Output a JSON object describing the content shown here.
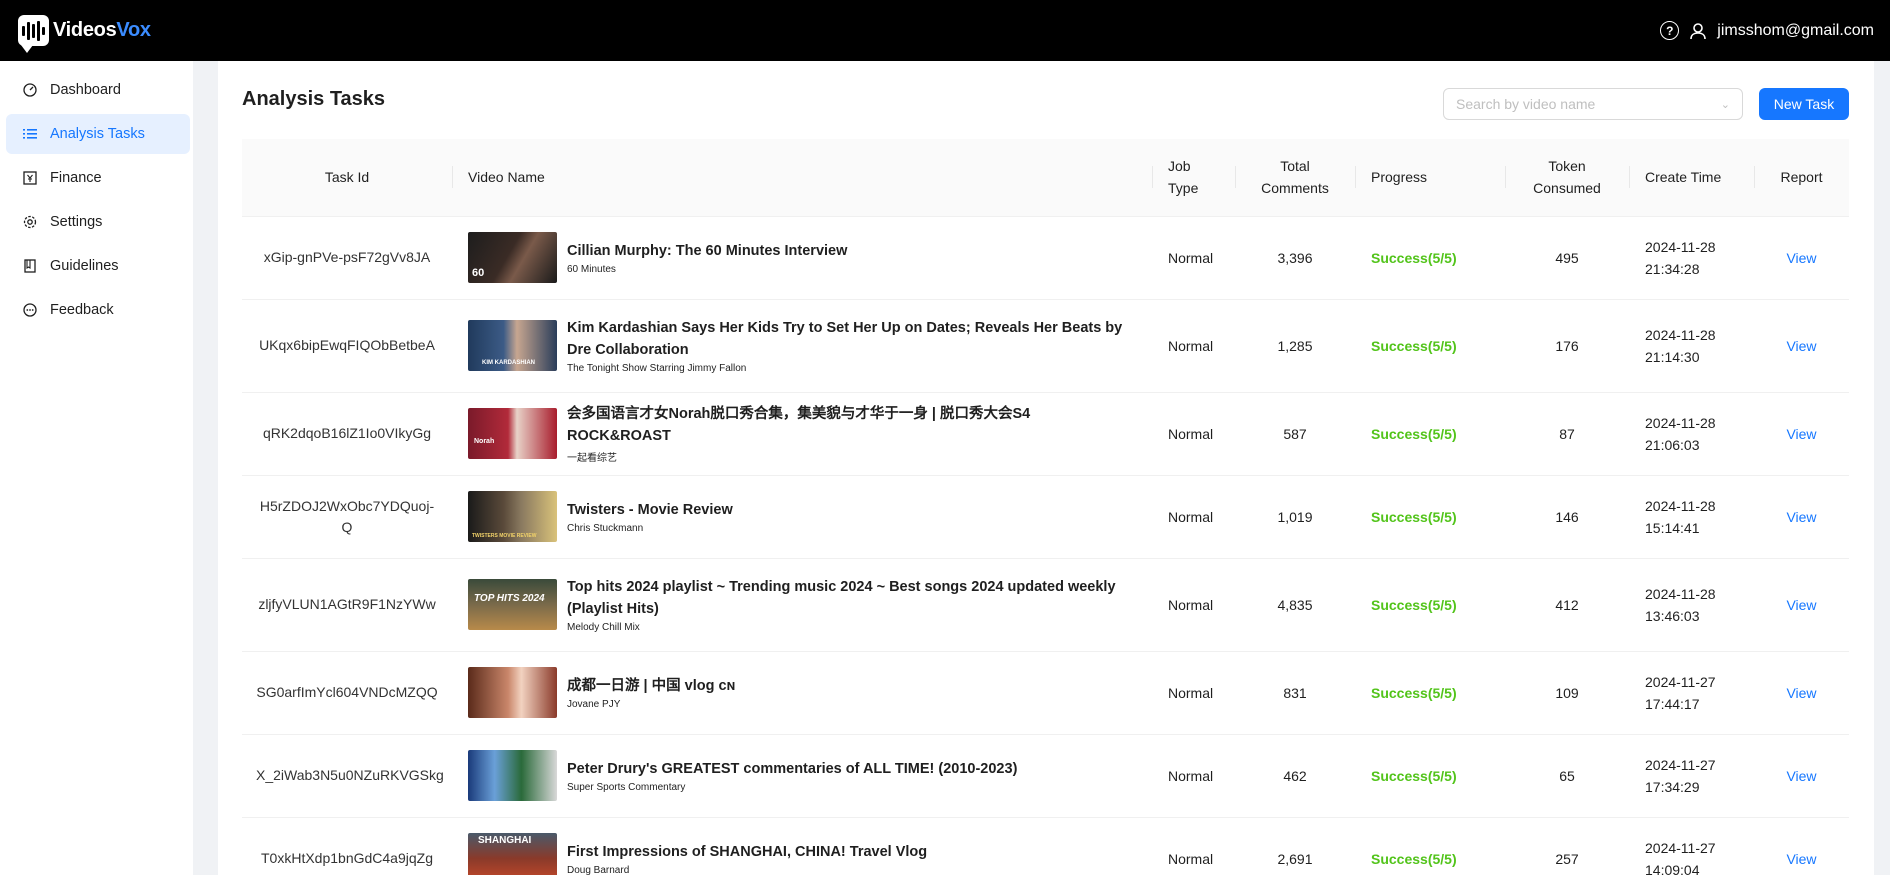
{
  "brand": {
    "name_part1": "Videos",
    "name_part2": "Vox"
  },
  "header": {
    "user_email": "jimsshom@gmail.com"
  },
  "sidebar": {
    "items": [
      {
        "label": "Dashboard",
        "icon": "dashboard-icon"
      },
      {
        "label": "Analysis Tasks",
        "icon": "list-icon",
        "active": true
      },
      {
        "label": "Finance",
        "icon": "finance-icon"
      },
      {
        "label": "Settings",
        "icon": "gear-icon"
      },
      {
        "label": "Guidelines",
        "icon": "book-icon"
      },
      {
        "label": "Feedback",
        "icon": "chat-icon"
      }
    ]
  },
  "main": {
    "title": "Analysis Tasks",
    "search_placeholder": "Search by video name",
    "new_task_label": "New Task"
  },
  "table": {
    "headers": {
      "task_id": "Task Id",
      "video_name": "Video Name",
      "job_type_1": "Job",
      "job_type_2": "Type",
      "total_comments_1": "Total",
      "total_comments_2": "Comments",
      "progress": "Progress",
      "token_consumed_1": "Token",
      "token_consumed_2": "Consumed",
      "create_time": "Create Time",
      "report": "Report"
    },
    "rows": [
      {
        "task_id": "xGip-gnPVe-psF72gVv8JA",
        "title": "Cillian Murphy: The 60 Minutes Interview",
        "channel": "60 Minutes",
        "job_type": "Normal",
        "total_comments": "3,396",
        "progress": "Success(5/5)",
        "tokens": "495",
        "date": "2024-11-28",
        "time": "21:34:28",
        "report": "View"
      },
      {
        "task_id": "UKqx6bipEwqFIQObBetbeA",
        "title": "Kim Kardashian Says Her Kids Try to Set Her Up on Dates; Reveals Her Beats by Dre Collaboration",
        "channel": "The Tonight Show Starring Jimmy Fallon",
        "job_type": "Normal",
        "total_comments": "1,285",
        "progress": "Success(5/5)",
        "tokens": "176",
        "date": "2024-11-28",
        "time": "21:14:30",
        "report": "View"
      },
      {
        "task_id": "qRK2dqoB16lZ1Io0VIkyGg",
        "title": "会多国语言才女Norah脱口秀合集，集美貌与才华于一身 | 脱口秀大会S4 ROCK&ROAST",
        "channel": "一起看综艺",
        "job_type": "Normal",
        "total_comments": "587",
        "progress": "Success(5/5)",
        "tokens": "87",
        "date": "2024-11-28",
        "time": "21:06:03",
        "report": "View"
      },
      {
        "task_id": "H5rZDOJ2WxObc7YDQuoj-Q",
        "title": "Twisters - Movie Review",
        "channel": "Chris Stuckmann",
        "job_type": "Normal",
        "total_comments": "1,019",
        "progress": "Success(5/5)",
        "tokens": "146",
        "date": "2024-11-28",
        "time": "15:14:41",
        "report": "View"
      },
      {
        "task_id": "zljfyVLUN1AGtR9F1NzYWw",
        "title": "Top hits 2024 playlist ~ Trending music 2024 ~ Best songs 2024 updated weekly (Playlist Hits)",
        "channel": "Melody Chill Mix",
        "job_type": "Normal",
        "total_comments": "4,835",
        "progress": "Success(5/5)",
        "tokens": "412",
        "date": "2024-11-28",
        "time": "13:46:03",
        "report": "View"
      },
      {
        "task_id": "SG0arfImYcl604VNDcMZQQ",
        "title": "成都一日游 | 中国 vlog ᴄɴ",
        "channel": "Jovane PJY",
        "job_type": "Normal",
        "total_comments": "831",
        "progress": "Success(5/5)",
        "tokens": "109",
        "date": "2024-11-27",
        "time": "17:44:17",
        "report": "View"
      },
      {
        "task_id": "X_2iWab3N5u0NZuRKVGSkg",
        "title": "Peter Drury's GREATEST commentaries of ALL TIME! (2010-2023)",
        "channel": "Super Sports Commentary",
        "job_type": "Normal",
        "total_comments": "462",
        "progress": "Success(5/5)",
        "tokens": "65",
        "date": "2024-11-27",
        "time": "17:34:29",
        "report": "View"
      },
      {
        "task_id": "T0xkHtXdp1bnGdC4a9jqZg",
        "title": "First Impressions of SHANGHAI, CHINA! Travel Vlog",
        "channel": "Doug Barnard",
        "job_type": "Normal",
        "total_comments": "2,691",
        "progress": "Success(5/5)",
        "tokens": "257",
        "date": "2024-11-27",
        "time": "14:09:04",
        "report": "View"
      }
    ],
    "thumb_labels": [
      "60",
      "KIM KARDASHIAN",
      "Norah",
      "TWISTERS MOVIE REVIEW",
      "TOP HITS 2024",
      "",
      "",
      "SHANGHAI"
    ]
  },
  "colors": {
    "accent": "#1677ff",
    "success": "#52c41a",
    "topbar": "#000000"
  }
}
